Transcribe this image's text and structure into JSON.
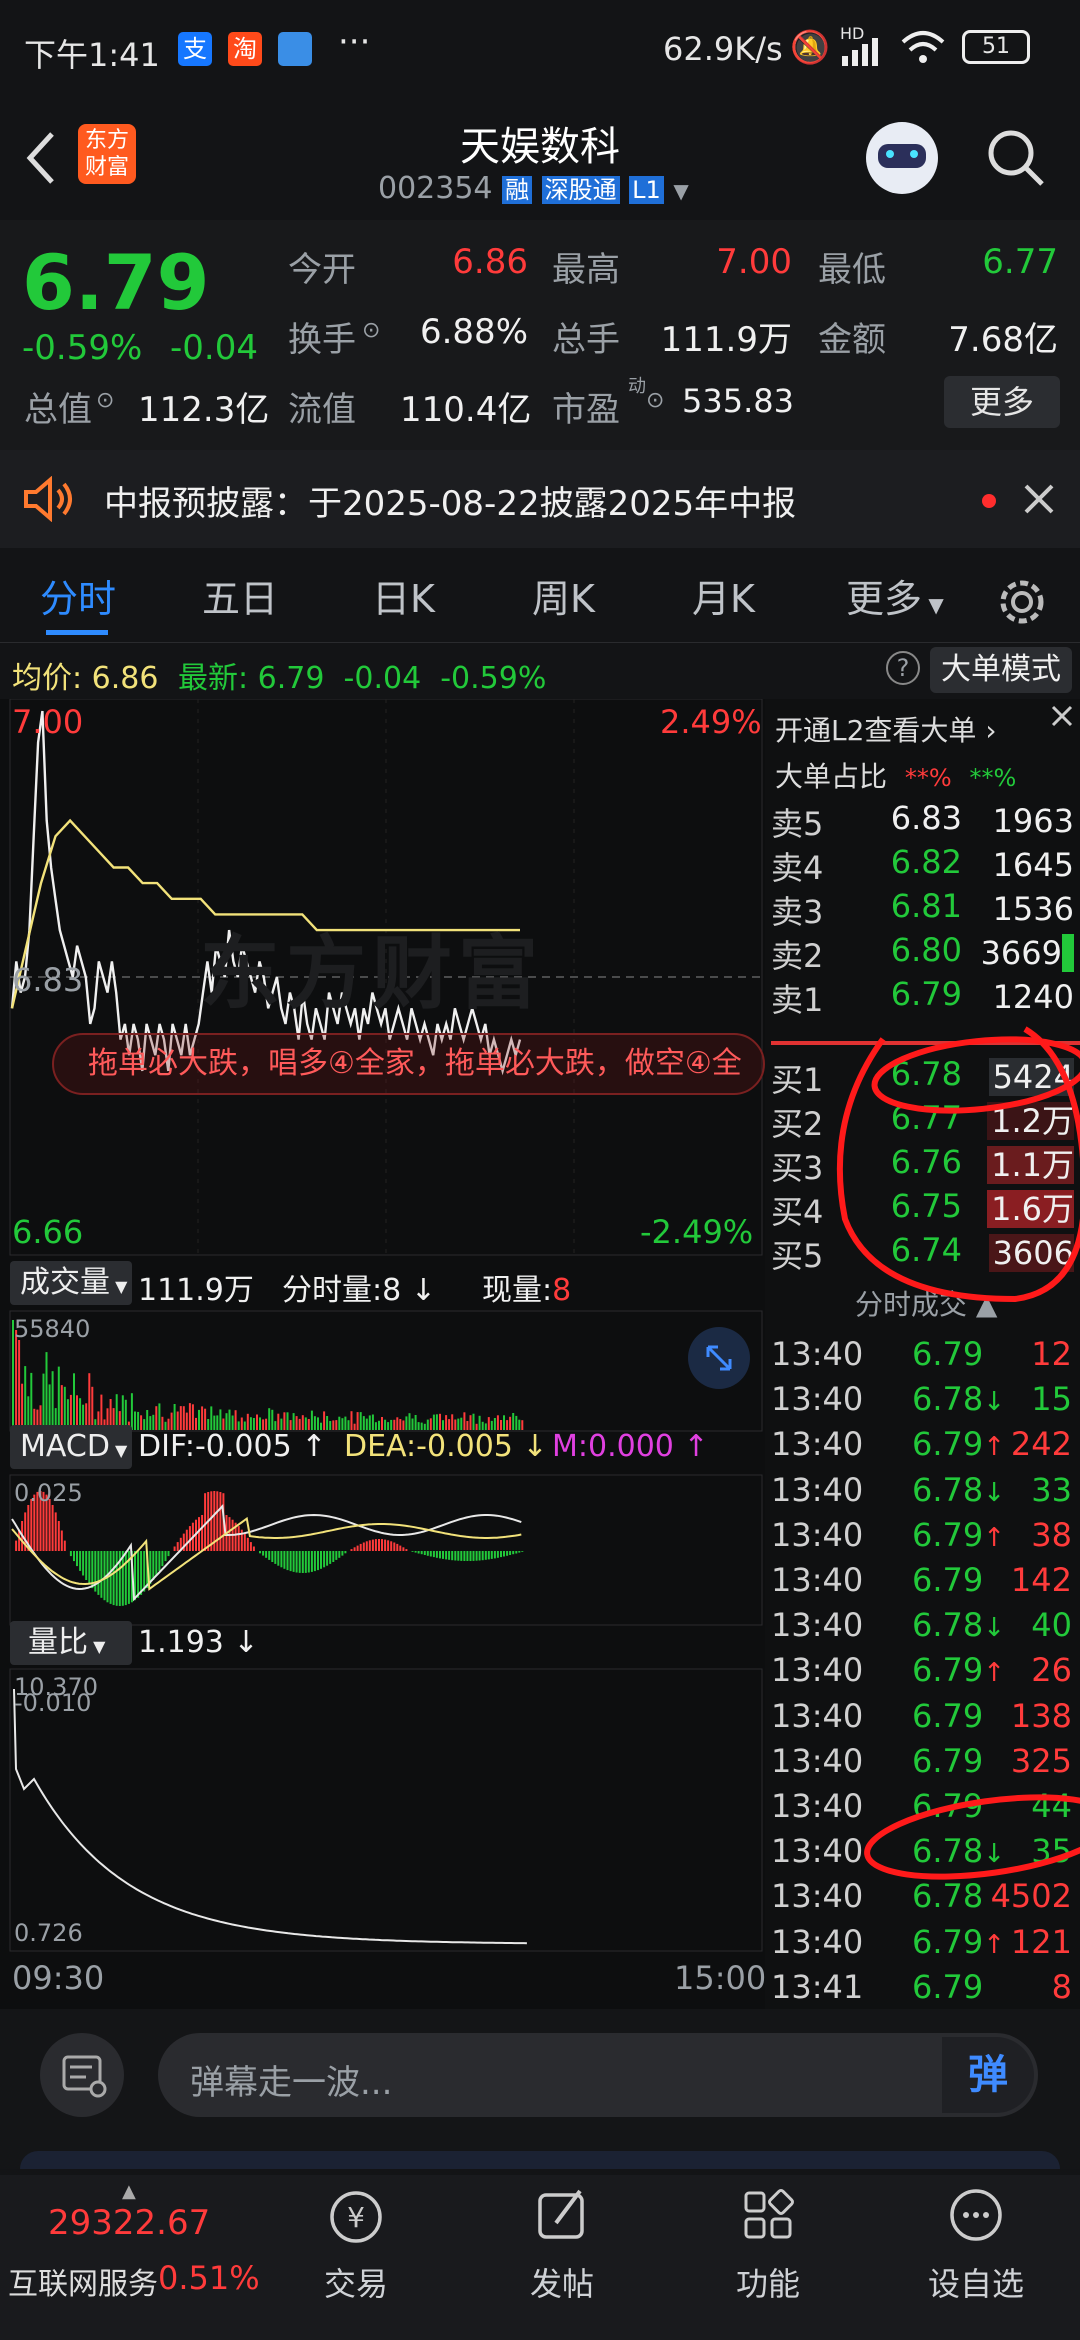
{
  "status": {
    "time": "下午1:41",
    "net": "62.9K/s",
    "battery": "51",
    "hd": "HD"
  },
  "header": {
    "logo_line1": "东方",
    "logo_line2": "财富",
    "title": "天娱数科",
    "code": "002354",
    "tag_rong": "融",
    "tag_sgt": "深股通",
    "tag_l1": "L1"
  },
  "quote": {
    "price": "6.79",
    "pct": "-0.59%",
    "chg": "-0.04",
    "open_label": "今开",
    "open": "6.86",
    "high_label": "最高",
    "high": "7.00",
    "low_label": "最低",
    "low": "6.77",
    "turnover_label": "换手",
    "turnover": "6.88%",
    "vol_label": "总手",
    "vol": "111.9万",
    "amt_label": "金额",
    "amt": "7.68亿",
    "mcap_label": "总值",
    "mcap": "112.3亿",
    "float_label": "流值",
    "float": "110.4亿",
    "pe_label": "市盈",
    "pe_sup": "动",
    "pe": "535.83",
    "more": "更多"
  },
  "notice": {
    "text": "中报预披露：于2025-08-22披露2025年中报"
  },
  "tabs": [
    "分时",
    "五日",
    "日K",
    "周K",
    "月K",
    "更多"
  ],
  "infoline": {
    "avg_label": "均价:",
    "avg": "6.86",
    "latest_label": "最新:",
    "latest": "6.79",
    "chg": "-0.04",
    "pct": "-0.59%",
    "mode": "大单模式"
  },
  "chart": {
    "y_top": "7.00",
    "y_mid": "6.83",
    "y_bot": "6.66",
    "pct_top": "2.49%",
    "pct_bot": "-2.49%",
    "danmaku": "拖单必大跌，唱多④全家，拖单必大跌，做空④全",
    "watermark": "东方财富",
    "vol_label": "成交量",
    "vol_total": "111.9万",
    "fs_label": "分时量:8",
    "cur_label": "现量:",
    "cur_val": "8",
    "vol_max": "55840",
    "macd_label": "MACD",
    "dif": "DIF:-0.005",
    "dea": "DEA:-0.005",
    "m": "M:0.000",
    "macd_top": "0.025",
    "macd_bot": "-0.010",
    "lb_label": "量比",
    "lb_val": "1.193",
    "lb_top": "10.370",
    "lb_bot": "0.726",
    "t_start": "09:30",
    "t_end": "15:00"
  },
  "chart_data": {
    "type": "line",
    "series": [
      {
        "values": [
          6.81,
          6.84,
          6.82,
          6.83,
          6.86,
          6.92,
          6.98,
          7.0,
          6.93,
          6.9,
          6.88,
          6.86,
          6.85,
          6.84,
          6.83,
          6.85,
          6.84,
          6.83,
          6.8,
          6.81,
          6.84,
          6.83,
          6.82,
          6.84,
          6.82,
          6.79,
          6.8,
          6.78,
          6.8,
          6.79,
          6.77,
          6.8,
          6.79,
          6.78,
          6.8,
          6.79,
          6.77,
          6.8,
          6.79,
          6.78,
          6.8,
          6.78,
          6.79,
          6.8,
          6.82,
          6.84,
          6.82,
          6.85,
          6.84,
          6.83,
          6.86,
          6.84,
          6.83,
          6.85,
          6.84,
          6.83,
          6.82,
          6.84,
          6.83,
          6.81,
          6.82,
          6.83,
          6.81,
          6.8,
          6.82,
          6.81,
          6.79,
          6.82,
          6.8,
          6.79,
          6.81,
          6.8,
          6.79,
          6.82,
          6.81,
          6.8,
          6.82,
          6.81,
          6.8,
          6.81,
          6.79,
          6.81,
          6.8,
          6.82,
          6.81,
          6.8,
          6.81,
          6.79,
          6.8,
          6.81,
          6.8,
          6.79,
          6.81,
          6.8,
          6.79,
          6.8,
          6.79,
          6.78,
          6.8,
          6.79,
          6.8,
          6.79,
          6.81,
          6.8,
          6.79,
          6.8,
          6.81,
          6.8,
          6.79,
          6.8,
          6.78,
          6.79,
          6.78,
          6.77,
          6.78,
          6.79,
          6.78,
          6.79
        ]
      },
      {
        "values": [
          6.81,
          6.85,
          6.89,
          6.92,
          6.93,
          6.92,
          6.91,
          6.9,
          6.9,
          6.89,
          6.89,
          6.88,
          6.88,
          6.88,
          6.87,
          6.87,
          6.87,
          6.87,
          6.87,
          6.87,
          6.87,
          6.86,
          6.86,
          6.86,
          6.86,
          6.86,
          6.86,
          6.86,
          6.86,
          6.86,
          6.86,
          6.86,
          6.86,
          6.86,
          6.86,
          6.86
        ]
      }
    ],
    "ylim": [
      6.66,
      7.0
    ]
  },
  "book": {
    "l2": "开通L2查看大单",
    "ratio_label": "大单占比",
    "ratio_up": "**%",
    "ratio_dn": "**%",
    "asks": [
      {
        "l": "卖5",
        "p": "6.83",
        "v": "1963"
      },
      {
        "l": "卖4",
        "p": "6.82",
        "v": "1645"
      },
      {
        "l": "卖3",
        "p": "6.81",
        "v": "1536"
      },
      {
        "l": "卖2",
        "p": "6.80",
        "v": "3669"
      },
      {
        "l": "卖1",
        "p": "6.79",
        "v": "1240"
      }
    ],
    "bids": [
      {
        "l": "买1",
        "p": "6.78",
        "v": "5424"
      },
      {
        "l": "买2",
        "p": "6.77",
        "v": "1.2万"
      },
      {
        "l": "买3",
        "p": "6.76",
        "v": "1.1万"
      },
      {
        "l": "买4",
        "p": "6.75",
        "v": "1.6万"
      },
      {
        "l": "买5",
        "p": "6.74",
        "v": "3606"
      }
    ],
    "ticks_label": "分时成交",
    "ticks": [
      {
        "t": "13:40",
        "p": "6.79",
        "a": "",
        "v": "12"
      },
      {
        "t": "13:40",
        "p": "6.78",
        "a": "↓",
        "v": "15"
      },
      {
        "t": "13:40",
        "p": "6.79",
        "a": "↑",
        "v": "242"
      },
      {
        "t": "13:40",
        "p": "6.78",
        "a": "↓",
        "v": "33"
      },
      {
        "t": "13:40",
        "p": "6.79",
        "a": "↑",
        "v": "38"
      },
      {
        "t": "13:40",
        "p": "6.79",
        "a": "",
        "v": "142"
      },
      {
        "t": "13:40",
        "p": "6.78",
        "a": "↓",
        "v": "40"
      },
      {
        "t": "13:40",
        "p": "6.79",
        "a": "↑",
        "v": "26"
      },
      {
        "t": "13:40",
        "p": "6.79",
        "a": "",
        "v": "138"
      },
      {
        "t": "13:40",
        "p": "6.79",
        "a": "",
        "v": "325"
      },
      {
        "t": "13:40",
        "p": "6.79",
        "a": "",
        "v": "44"
      },
      {
        "t": "13:40",
        "p": "6.78",
        "a": "↓",
        "v": "35"
      },
      {
        "t": "13:40",
        "p": "6.78",
        "a": "",
        "v": "4502"
      },
      {
        "t": "13:40",
        "p": "6.79",
        "a": "↑",
        "v": "121"
      },
      {
        "t": "13:41",
        "p": "6.79",
        "a": "",
        "v": "8"
      }
    ]
  },
  "input": {
    "placeholder": "弹幕走一波...",
    "send": "弹"
  },
  "bottomnav": {
    "index_val": "29322.67",
    "index_name": "互联网服务",
    "index_pct": "0.51%",
    "items": [
      "交易",
      "发帖",
      "功能",
      "设自选"
    ]
  }
}
